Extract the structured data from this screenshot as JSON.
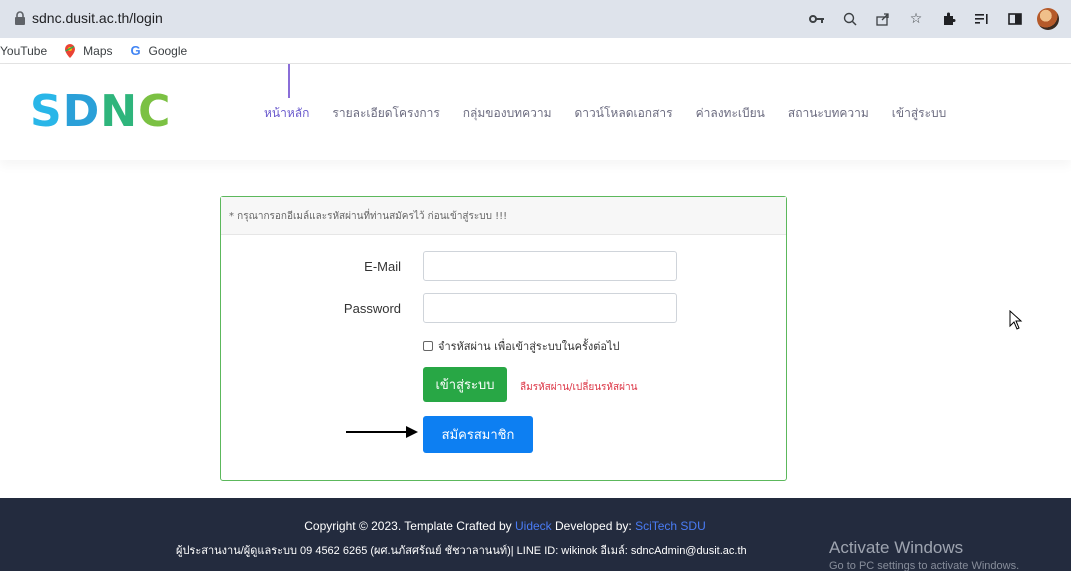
{
  "browser": {
    "url": "sdnc.dusit.ac.th/login",
    "icons": [
      "key-icon",
      "zoom-icon",
      "share-icon",
      "star-icon",
      "extensions-icon",
      "reading-list-icon",
      "side-panel-icon",
      "profile-avatar"
    ],
    "bookmarks": [
      {
        "label": "YouTube",
        "icon": "youtube-icon"
      },
      {
        "label": "Maps",
        "icon": "maps-icon"
      },
      {
        "label": "Google",
        "icon": "google-icon"
      }
    ]
  },
  "site": {
    "logo": {
      "s": "S",
      "d": "D",
      "n": "N",
      "c": "C"
    },
    "nav": [
      {
        "label": "หน้าหลัก",
        "active": true
      },
      {
        "label": "รายละเอียดโครงการ",
        "active": false
      },
      {
        "label": "กลุ่มของบทความ",
        "active": false
      },
      {
        "label": "ดาวน์โหลดเอกสาร",
        "active": false
      },
      {
        "label": "ค่าลงทะเบียน",
        "active": false
      },
      {
        "label": "สถานะบทความ",
        "active": false
      },
      {
        "label": "เข้าสู่ระบบ",
        "active": false
      }
    ]
  },
  "login": {
    "notice": "* กรุณากรอกอีเมล์และรหัสผ่านที่ท่านสมัครไว้ ก่อนเข้าสู่ระบบ !!!",
    "email_label": "E-Mail",
    "email_value": "",
    "password_label": "Password",
    "password_value": "",
    "remember_label": "จำรหัสผ่าน เพื่อเข้าสู่ระบบในครั้งต่อไป",
    "login_button": "เข้าสู่ระบบ",
    "forgot_link": "ลืมรหัสผ่าน/เปลี่ยนรหัสผ่าน",
    "register_button": "สมัครสมาชิก"
  },
  "footer": {
    "copyright_prefix": "Copyright © 2023. Template Crafted by ",
    "uideck": "Uideck",
    "developed_by": " Developed by: ",
    "scitech": "SciTech SDU",
    "contact": "ผู้ประสานงาน/ผู้ดูแลระบบ 09 4562 6265 (ผศ.นภัสศรัณย์ ชัชวาลานนท์)| LINE ID: wikinok อีเมล์: sdncAdmin@dusit.ac.th"
  },
  "watermark": {
    "title": "Activate Windows",
    "subtitle": "Go to PC settings to activate Windows."
  },
  "colors": {
    "primary": "#0d7ff2",
    "success": "#28a745",
    "danger": "#dc3545",
    "footer_bg": "#232b3e",
    "nav_active": "#6a5acd"
  }
}
